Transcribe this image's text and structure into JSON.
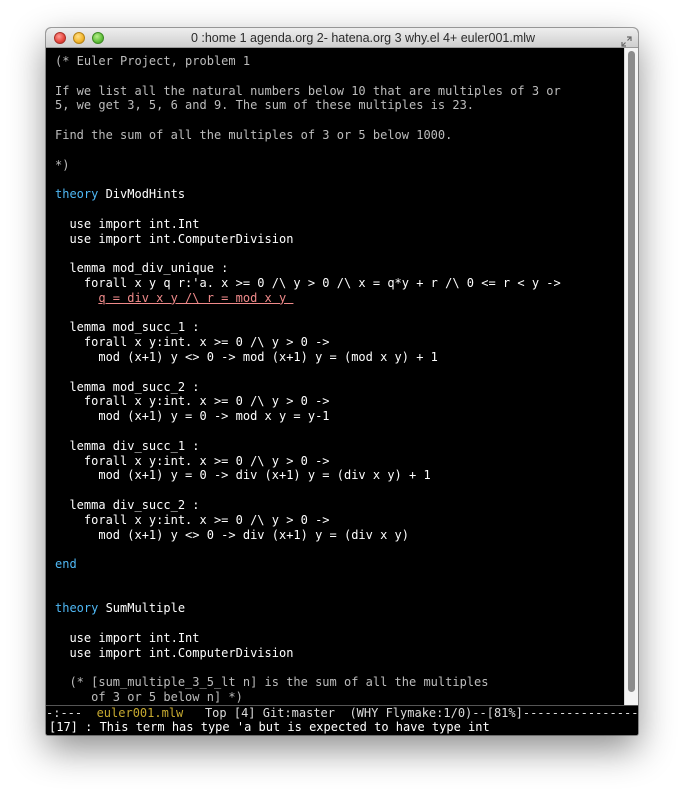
{
  "window": {
    "title": "0  :home 1  agenda.org 2- hatena.org 3  why.el 4+ euler001.mlw"
  },
  "colors": {
    "editor_background": "#000000",
    "default_text": "#ffffff",
    "comment": "#bdbdbd",
    "keyword": "#4fb8f5",
    "error_underline": "#ef8a8a",
    "modeline_buffer_name": "#c7aa30"
  },
  "editor": {
    "lines": [
      [
        {
          "t": "(* Euler Project, problem 1",
          "c": "comment"
        }
      ],
      [],
      [
        {
          "t": "If we list all the natural numbers below 10 that are multiples of 3 or",
          "c": "comment"
        }
      ],
      [
        {
          "t": "5, we get 3, 5, 6 and 9. The sum of these multiples is 23.",
          "c": "comment"
        }
      ],
      [],
      [
        {
          "t": "Find the sum of all the multiples of 3 or 5 below 1000.",
          "c": "comment"
        }
      ],
      [],
      [
        {
          "t": "*)",
          "c": "comment"
        }
      ],
      [],
      [
        {
          "t": "theory",
          "c": "keyword"
        },
        {
          "t": " DivModHints"
        }
      ],
      [],
      [
        {
          "t": "  use import int.Int"
        }
      ],
      [
        {
          "t": "  use import int.ComputerDivision"
        }
      ],
      [],
      [
        {
          "t": "  lemma mod_div_unique :"
        }
      ],
      [
        {
          "t": "    forall x y q r:'a. x >= 0 /\\ y > 0 /\\ x = q*y + r /\\ 0 <= r < y ->"
        }
      ],
      [
        {
          "t": "      "
        },
        {
          "t": "q = div x y /\\ r = mod x y ",
          "c": "error"
        }
      ],
      [],
      [
        {
          "t": "  lemma mod_succ_1 :"
        }
      ],
      [
        {
          "t": "    forall x y:int. x >= 0 /\\ y > 0 ->"
        }
      ],
      [
        {
          "t": "      mod (x+1) y <> 0 -> mod (x+1) y = (mod x y) + 1"
        }
      ],
      [],
      [
        {
          "t": "  lemma mod_succ_2 :"
        }
      ],
      [
        {
          "t": "    forall x y:int. x >= 0 /\\ y > 0 ->"
        }
      ],
      [
        {
          "t": "      mod (x+1) y = 0 -> mod x y = y-1"
        }
      ],
      [],
      [
        {
          "t": "  lemma div_succ_1 :"
        }
      ],
      [
        {
          "t": "    forall x y:int. x >= 0 /\\ y > 0 ->"
        }
      ],
      [
        {
          "t": "      mod (x+1) y = 0 -> div (x+1) y = (div x y) + 1"
        }
      ],
      [],
      [
        {
          "t": "  lemma div_succ_2 :"
        }
      ],
      [
        {
          "t": "    forall x y:int. x >= 0 /\\ y > 0 ->"
        }
      ],
      [
        {
          "t": "      mod (x+1) y <> 0 -> div (x+1) y = (div x y)"
        }
      ],
      [],
      [
        {
          "t": "end",
          "c": "keyword"
        }
      ],
      [],
      [],
      [
        {
          "t": "theory",
          "c": "keyword"
        },
        {
          "t": " SumMultiple"
        }
      ],
      [],
      [
        {
          "t": "  use import int.Int"
        }
      ],
      [
        {
          "t": "  use import int.ComputerDivision"
        }
      ],
      [],
      [
        {
          "t": "  (* [sum_multiple_3_5_lt n] is the sum of all the multiples",
          "c": "comment"
        }
      ],
      [
        {
          "t": "     of 3 or 5 below n] *)",
          "c": "comment"
        }
      ]
    ]
  },
  "modeline": {
    "prefix": "-:---  ",
    "buffer_name": "euler001.mlw",
    "rest": "   Top [4] Git:master  (WHY Flymake:1/0)--[81%]------------------------------"
  },
  "minibuffer": {
    "message": "[17] : This term has type 'a but is expected to have type int"
  }
}
